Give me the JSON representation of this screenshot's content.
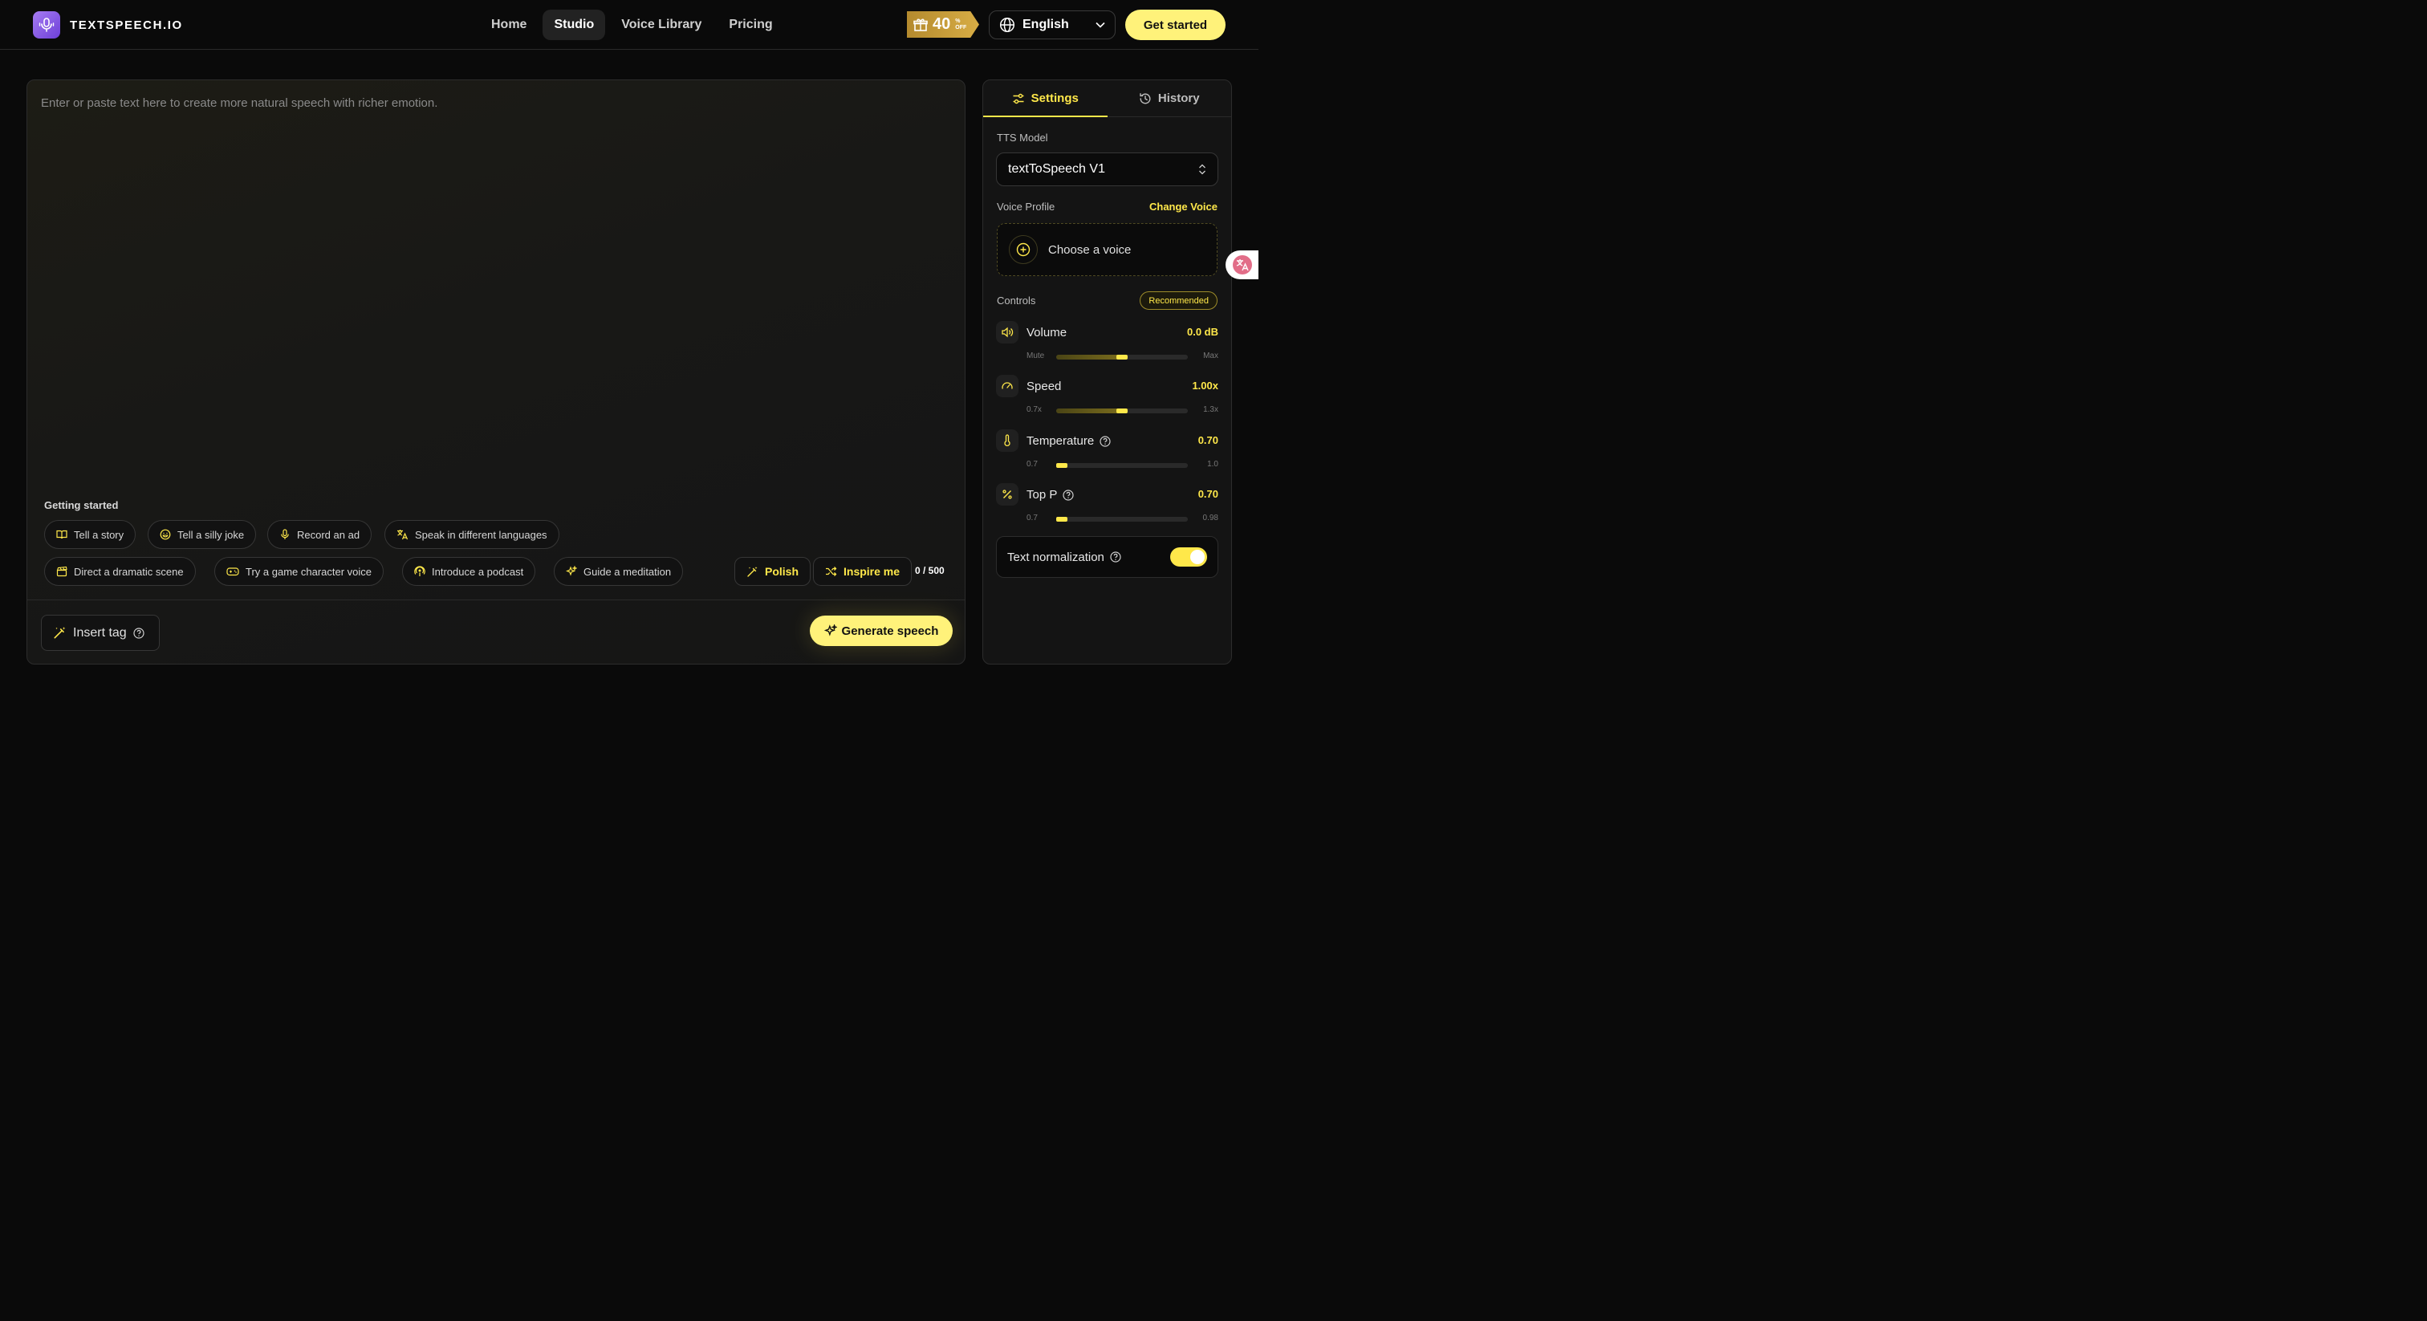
{
  "header": {
    "logo_text": "TEXTSPEECH.IO",
    "nav": [
      {
        "label": "Home",
        "active": false
      },
      {
        "label": "Studio",
        "active": true
      },
      {
        "label": "Voice Library",
        "active": false
      },
      {
        "label": "Pricing",
        "active": false
      }
    ],
    "promo": {
      "value": "40",
      "unit": "%",
      "off": "OFF"
    },
    "language": "English",
    "cta_label": "Get started"
  },
  "editor": {
    "placeholder": "Enter or paste text here to create more natural speech with richer emotion.",
    "getting_started_title": "Getting started",
    "prompts_row1": [
      "Tell a story",
      "Tell a silly joke",
      "Record an ad",
      "Speak in different languages"
    ],
    "prompts_row2": [
      "Direct a dramatic scene",
      "Try a game character voice",
      "Introduce a podcast",
      "Guide a meditation"
    ],
    "polish_label": "Polish",
    "inspire_label": "Inspire me",
    "char_count": "0 / 500",
    "insert_tag_label": "Insert tag",
    "generate_label": "Generate speech"
  },
  "settings": {
    "tabs": [
      {
        "label": "Settings",
        "icon": "sliders-icon",
        "active": true
      },
      {
        "label": "History",
        "icon": "history-icon",
        "active": false
      }
    ],
    "tts_model_label": "TTS Model",
    "tts_model_value": "textToSpeech V1",
    "voice_profile_label": "Voice Profile",
    "change_voice_label": "Change Voice",
    "choose_voice_label": "Choose a voice",
    "controls_label": "Controls",
    "recommended_badge": "Recommended",
    "controls": [
      {
        "name": "Volume",
        "value": "0.0 dB",
        "min": "Mute",
        "max": "Max",
        "level": 0.5,
        "help": false,
        "icon": "speaker-icon"
      },
      {
        "name": "Speed",
        "value": "1.00x",
        "min": "0.7x",
        "max": "1.3x",
        "level": 0.5,
        "help": false,
        "icon": "gauge-icon"
      },
      {
        "name": "Temperature",
        "value": "0.70",
        "min": "0.7",
        "max": "1.0",
        "level": 0.0,
        "help": true,
        "icon": "thermometer-icon"
      },
      {
        "name": "Top P",
        "value": "0.70",
        "min": "0.7",
        "max": "0.98",
        "level": 0.0,
        "help": true,
        "icon": "percent-icon"
      }
    ],
    "text_normalization_label": "Text normalization",
    "text_normalization_on": true
  },
  "colors": {
    "accent": "#ffe84a",
    "cta": "#fff27a",
    "brand": "#8b5cf6",
    "background": "#0a0a0a"
  }
}
